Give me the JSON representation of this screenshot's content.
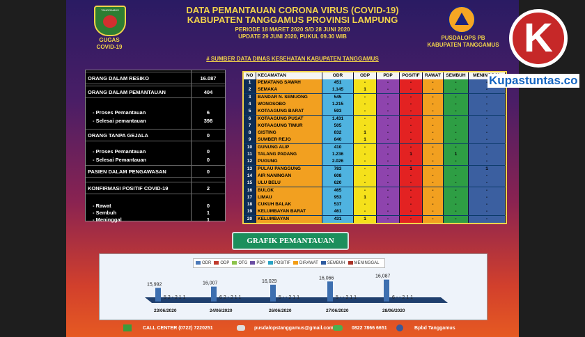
{
  "header": {
    "title1": "DATA PEMANTAUAN CORONA VIRUS (COVID-19)",
    "title2": "KABUPATEN TANGGAMUS PROVINSI LAMPUNG",
    "period": "PERIODE 18 MARET 2020 S/D 28 JUNI 2020",
    "update": "UPDATE 29 JUNI 2020, PUKUL 09.30 WIB",
    "source": "# SUMBER DATA DINAS  KESEHATAN KABUPATEN TANGGAMUS",
    "left_logo_text": "TANGGAMUS",
    "left_label_1": "GUGAS",
    "left_label_2": "COVID-19",
    "right_label_1": "PUSDALOPS PB",
    "right_label_2": "KABUPATEN TANGGAMUS"
  },
  "summary": [
    {
      "label": "ORANG DALAM RESIKO",
      "value": "16.087"
    },
    {
      "label": "ORANG DALAM PEMANTAUAN",
      "value": "404"
    },
    {
      "label": "- Proses Pemantauan",
      "value": "6"
    },
    {
      "label": "- Selesai pemantauan",
      "value": "398"
    },
    {
      "label": "ORANG TANPA GEJALA",
      "value": "0"
    },
    {
      "label": "- Proses Pemantauan",
      "value": "0"
    },
    {
      "label": "- Selesai Pemantauan",
      "value": "0"
    },
    {
      "label": "PASIEN DALAM PENGAWASAN",
      "value": "0"
    },
    {
      "label": "KONFIRMASI POSITIF COVID-19",
      "value": "2"
    },
    {
      "label": "- Rawat",
      "value": "0"
    },
    {
      "label": "- Sembuh",
      "value": "1"
    },
    {
      "label": "- Meninggal",
      "value": "1"
    }
  ],
  "table": {
    "headers": [
      "NO",
      "KECAMATAN",
      "ODR",
      "ODP",
      "PDP",
      "POSITIF",
      "RAWAT",
      "SEMBUH",
      "MENINGGAL"
    ],
    "rows": [
      [
        "1",
        "PEMATANG SAWAH",
        "451",
        "-",
        "-",
        "-",
        "-",
        "-",
        "-"
      ],
      [
        "2",
        "SEMAKA",
        "1.145",
        "1",
        "-",
        "-",
        "-",
        "-",
        "-"
      ],
      [
        "3",
        "BANDAR N. SEMUONG",
        "545",
        "-",
        "-",
        "-",
        "-",
        "-",
        "-"
      ],
      [
        "4",
        "WONOSOBO",
        "1.215",
        "-",
        "-",
        "-",
        "-",
        "-",
        "-"
      ],
      [
        "5",
        "KOTAAGUNG BARAT",
        "593",
        "-",
        "-",
        "-",
        "-",
        "-",
        "-"
      ],
      [
        "6",
        "KOTAAGUNG PUSAT",
        "1.431",
        "-",
        "-",
        "-",
        "-",
        "-",
        "-"
      ],
      [
        "7",
        "KOTAAGUNG TIMUR",
        "505",
        "-",
        "-",
        "-",
        "-",
        "-",
        "-"
      ],
      [
        "8",
        "GISTING",
        "832",
        "1",
        "-",
        "-",
        "-",
        "-",
        "-"
      ],
      [
        "9",
        "SUMBER REJO",
        "840",
        "1",
        "-",
        "-",
        "-",
        "-",
        "-"
      ],
      [
        "10",
        "GUNUNG ALIP",
        "410",
        "-",
        "-",
        "-",
        "-",
        "-",
        "-"
      ],
      [
        "11",
        "TALANG PADANG",
        "1.236",
        "-",
        "-",
        "1",
        "-",
        "1",
        "-"
      ],
      [
        "12",
        "PUGUNG",
        "2.026",
        "-",
        "-",
        "-",
        "-",
        "-",
        "-"
      ],
      [
        "13",
        "PULAU PANGGUNG",
        "783",
        "-",
        "-",
        "1",
        "-",
        "-",
        "1"
      ],
      [
        "14",
        "AIR NANINGAN",
        "608",
        "-",
        "-",
        "-",
        "-",
        "-",
        "-"
      ],
      [
        "15",
        "ULU BELU",
        "620",
        "-",
        "-",
        "-",
        "-",
        "-",
        "-"
      ],
      [
        "16",
        "BULOK",
        "465",
        "-",
        "-",
        "-",
        "-",
        "-",
        "-"
      ],
      [
        "17",
        "LIMAU",
        "953",
        "1",
        "-",
        "-",
        "-",
        "-",
        "-"
      ],
      [
        "18",
        "CUKUH BALAK",
        "537",
        "-",
        "-",
        "-",
        "-",
        "-",
        "-"
      ],
      [
        "19",
        "KELUMBAYAN BARAT",
        "461",
        "-",
        "-",
        "-",
        "-",
        "-",
        "-"
      ],
      [
        "20",
        "KELUMBAYAN",
        "431",
        "1",
        "-",
        "-",
        "-",
        "-",
        "-"
      ]
    ]
  },
  "grafik_label": "GRAFIK PEMANTAUAN",
  "chart_data": {
    "type": "bar",
    "categories": [
      "23/06/2020",
      "24/06/2020",
      "26/06/2020",
      "27/06/2020",
      "28/06/2020"
    ],
    "series": [
      {
        "name": "ODR",
        "values": [
          15992,
          16007,
          16029,
          16066,
          16087
        ]
      },
      {
        "name": "ODP",
        "values": [
          5,
          6,
          5,
          5,
          6
        ]
      },
      {
        "name": "OTG",
        "values": [
          0,
          0,
          0,
          0,
          0
        ]
      },
      {
        "name": "PDP",
        "values": [
          0,
          0,
          0,
          0,
          0
        ]
      },
      {
        "name": "POSITIF",
        "values": [
          2,
          2,
          2,
          2,
          2
        ]
      },
      {
        "name": "DIRAWAT",
        "values": [
          0,
          0,
          0,
          0,
          0
        ]
      },
      {
        "name": "SEMBUH",
        "values": [
          1,
          1,
          1,
          1,
          1
        ]
      },
      {
        "name": "MENINGGAL",
        "values": [
          1,
          1,
          1,
          1,
          1
        ]
      }
    ],
    "bar_labels": [
      "15,992",
      "16,007",
      "16,029",
      "16,066",
      "16,087"
    ],
    "small_labels": [
      [
        "5",
        "2",
        "-",
        "2",
        "1",
        "1"
      ],
      [
        "6",
        "2",
        "-",
        "2",
        "1",
        "1"
      ],
      [
        "5",
        "-",
        "-",
        "2",
        "1",
        "1"
      ],
      [
        "5",
        "-",
        "-",
        "2",
        "1",
        "1"
      ],
      [
        "6",
        "-",
        "-",
        "2",
        "1",
        "1"
      ]
    ],
    "legend_colors": [
      "#4a78b8",
      "#c0392b",
      "#8bc34a",
      "#6a4ea3",
      "#29a3c4",
      "#f39c12",
      "#2c5aa0",
      "#a93226"
    ],
    "legend_position": "top"
  },
  "footer": {
    "call_center": "CALL CENTER  (0722) 7220251",
    "email": "pusdalopstanggamus@gmail.com",
    "phone": "0822 7866 6651",
    "facebook": "Bpbd Tanggamus"
  },
  "watermark": {
    "letter": "K",
    "site": "Kupastuntas.co"
  }
}
